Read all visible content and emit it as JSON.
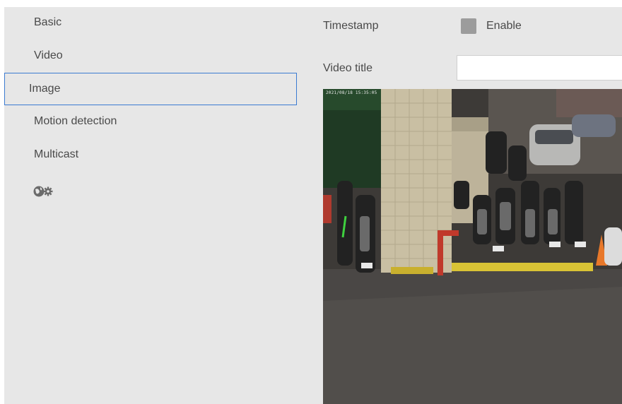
{
  "sidebar": {
    "items": [
      {
        "label": "Basic",
        "active": false
      },
      {
        "label": "Video",
        "active": false
      },
      {
        "label": "Image",
        "active": true
      },
      {
        "label": "Motion detection",
        "active": false
      },
      {
        "label": "Multicast",
        "active": false
      }
    ],
    "tools_icon": "globe-gear-icon"
  },
  "settings": {
    "timestamp_label": "Timestamp",
    "timestamp_enable_label": "Enable",
    "timestamp_enabled": false,
    "video_title_label": "Video title",
    "video_title_value": "",
    "video_title_placeholder": ""
  },
  "preview": {
    "overlay_timestamp": "2021/08/18 15:35:05"
  },
  "colors": {
    "panel_bg": "#e7e7e7",
    "active_border": "#3b7bd1",
    "checkbox_fill": "#9c9c9c",
    "text": "#4a4a4a"
  }
}
